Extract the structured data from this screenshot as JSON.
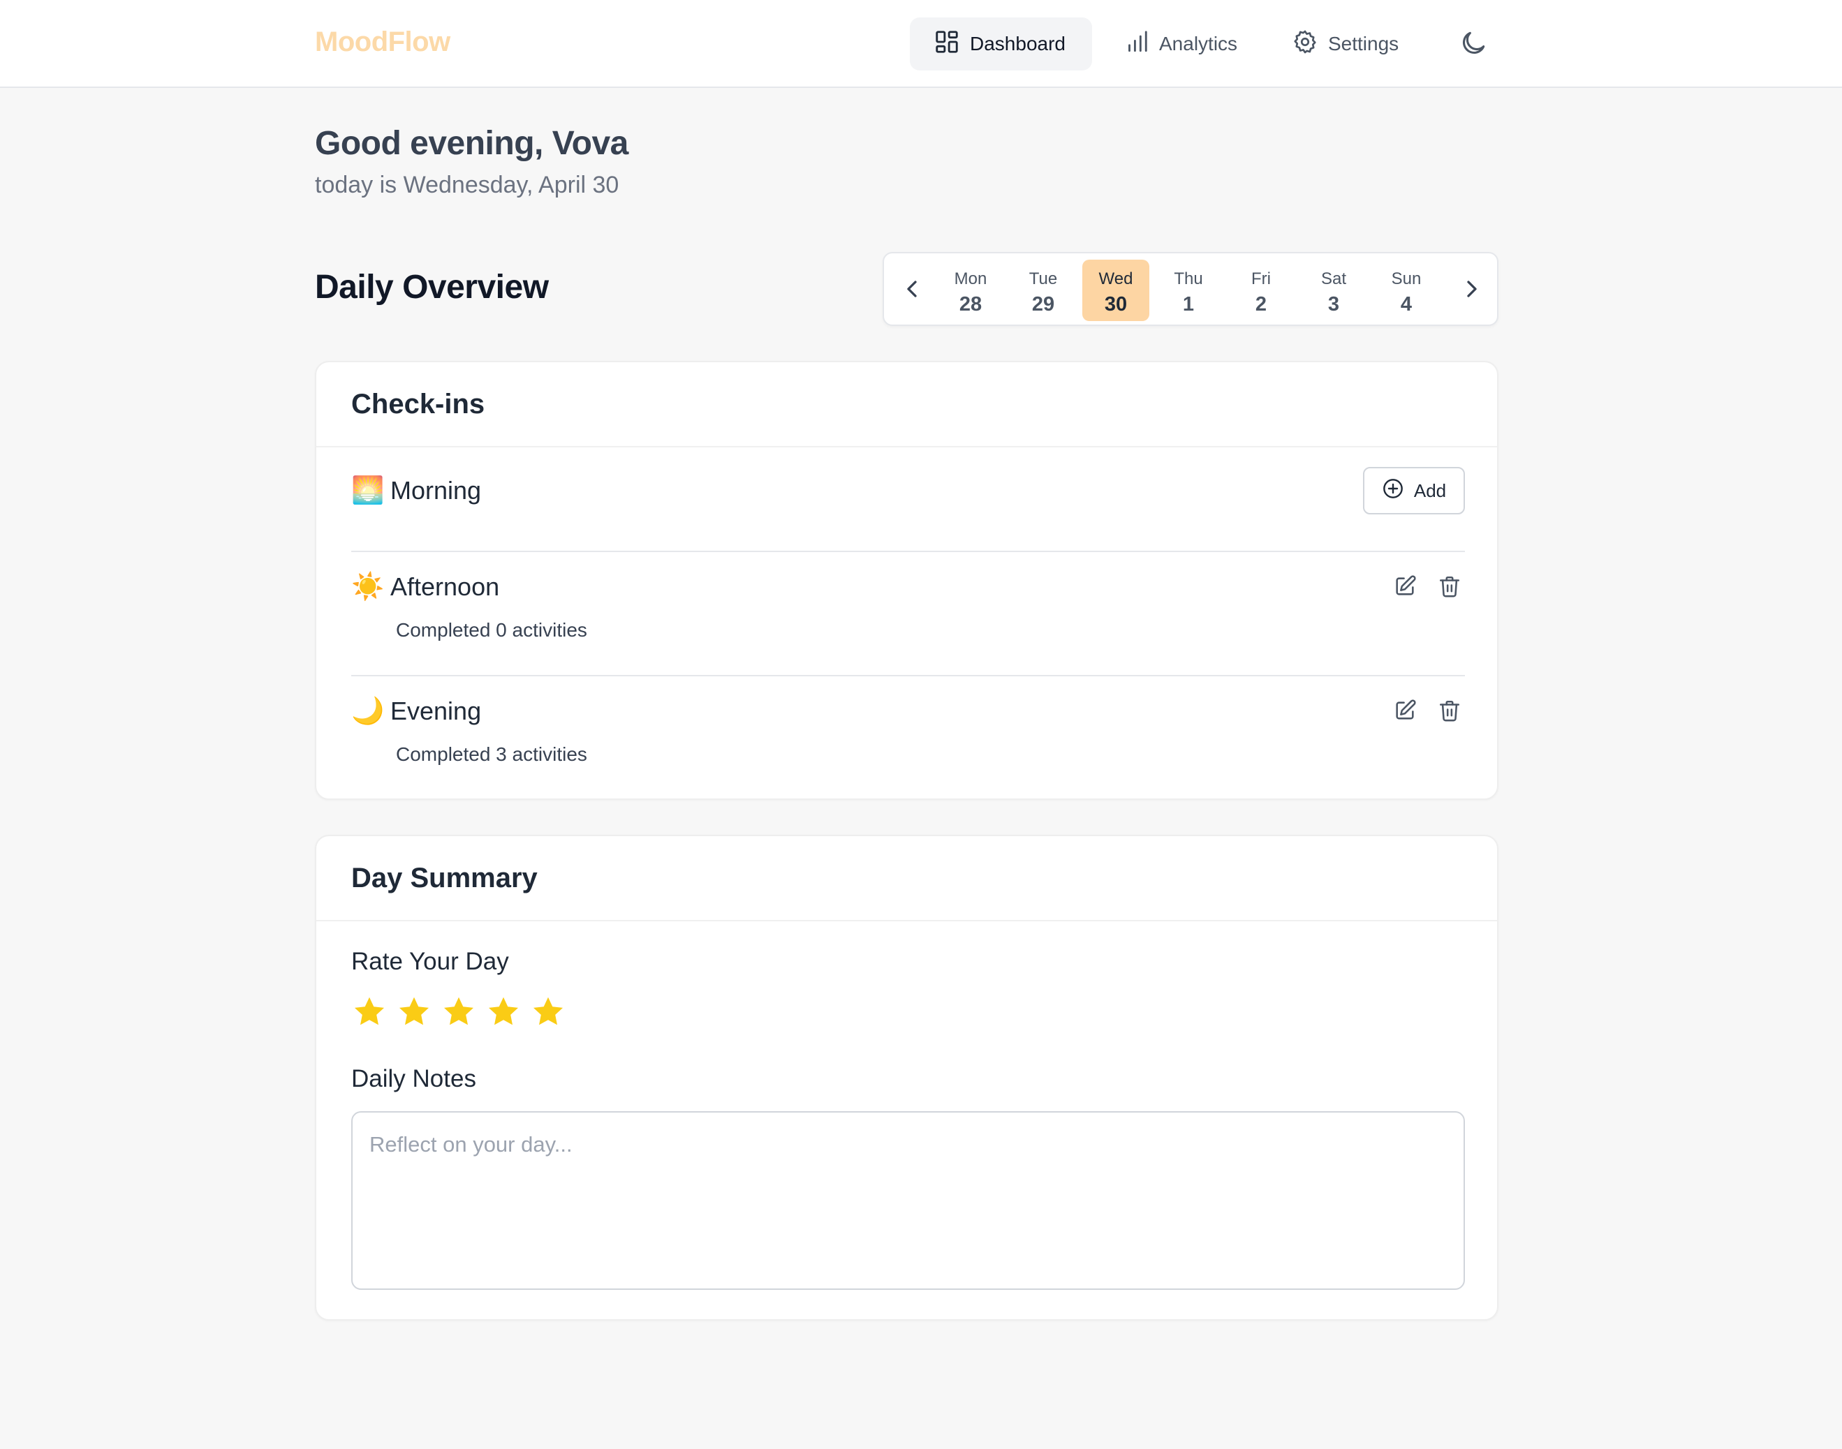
{
  "app": {
    "name": "MoodFlow",
    "accent": "#fdd5a3"
  },
  "nav": {
    "items": [
      {
        "label": "Dashboard",
        "icon": "dashboard-grid-icon",
        "active": true
      },
      {
        "label": "Analytics",
        "icon": "bar-chart-icon",
        "active": false
      },
      {
        "label": "Settings",
        "icon": "gear-icon",
        "active": false
      }
    ],
    "theme_icon": "moon-icon"
  },
  "header": {
    "greeting": "Good evening, Vova",
    "date_line": "today is Wednesday, April 30"
  },
  "overview": {
    "title": "Daily Overview",
    "days": [
      {
        "name": "Mon",
        "num": "28"
      },
      {
        "name": "Tue",
        "num": "29"
      },
      {
        "name": "Wed",
        "num": "30",
        "selected": true
      },
      {
        "name": "Thu",
        "num": "1"
      },
      {
        "name": "Fri",
        "num": "2"
      },
      {
        "name": "Sat",
        "num": "3"
      },
      {
        "name": "Sun",
        "num": "4"
      }
    ]
  },
  "checkins": {
    "title": "Check-ins",
    "items": [
      {
        "emoji": "🌅",
        "label": "Morning",
        "add_label": "Add"
      },
      {
        "emoji": "☀️",
        "label": "Afternoon",
        "summary": "Completed 0 activities"
      },
      {
        "emoji": "🌙",
        "label": "Evening",
        "summary": "Completed 3 activities"
      }
    ]
  },
  "summary": {
    "title": "Day Summary",
    "rate_label": "Rate Your Day",
    "rating": 5,
    "rating_max": 5,
    "star_color": "#facc15",
    "notes_label": "Daily Notes",
    "notes_placeholder": "Reflect on your day...",
    "notes_value": ""
  }
}
